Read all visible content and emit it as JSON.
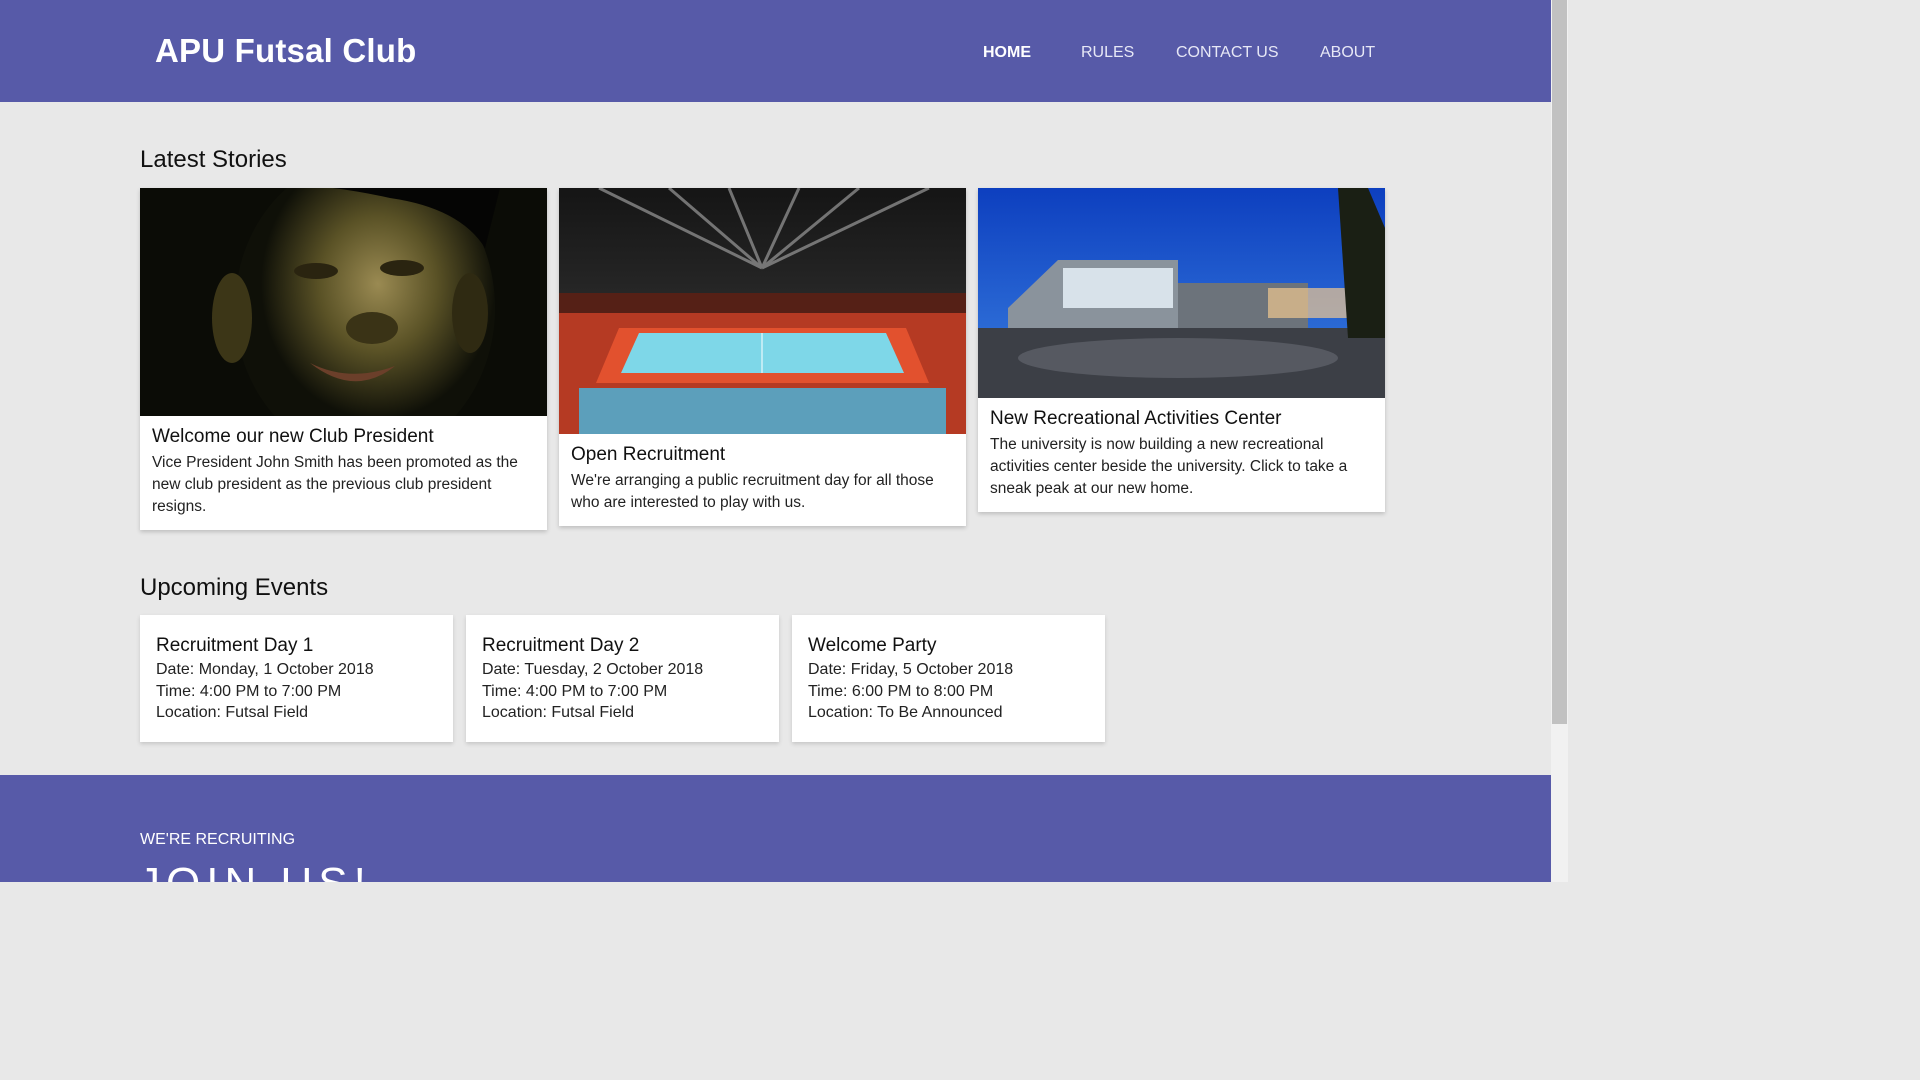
{
  "header": {
    "brand": "APU Futsal Club",
    "nav": [
      {
        "label": "HOME",
        "active": true
      },
      {
        "label": "RULES",
        "active": false
      },
      {
        "label": "CONTACT US",
        "active": false
      },
      {
        "label": "ABOUT",
        "active": false
      }
    ]
  },
  "stories": {
    "title": "Latest Stories",
    "items": [
      {
        "title": "Welcome our new Club President",
        "text": "Vice President John Smith has been promoted as the new club president as the previous club president resigns.",
        "image": "portrait-photo"
      },
      {
        "title": "Open Recruitment",
        "text": "We're arranging a public recruitment day for all those who are interested to play with us.",
        "image": "futsal-arena-photo"
      },
      {
        "title": "New Recreational Activities Center",
        "text": "The university is now building a new recreational activities center beside the university. Click to take a sneak peak at our new home.",
        "image": "building-night-photo"
      }
    ]
  },
  "events": {
    "title": "Upcoming Events",
    "items": [
      {
        "title": "Recruitment Day 1",
        "date": "Date: Monday, 1 October 2018",
        "time": "Time: 4:00 PM to 7:00 PM",
        "location": "Location: Futsal Field"
      },
      {
        "title": "Recruitment Day 2",
        "date": "Date: Tuesday, 2 October 2018",
        "time": "Time: 4:00 PM to 7:00 PM",
        "location": "Location: Futsal Field"
      },
      {
        "title": "Welcome Party",
        "date": "Date: Friday, 5 October 2018",
        "time": "Time: 6:00 PM to 8:00 PM",
        "location": "Location: To Be Announced"
      }
    ]
  },
  "recruit": {
    "kicker": "WE'RE RECRUITING",
    "headline": "JOIN US!"
  },
  "colors": {
    "header_bg": "#575aa8",
    "page_bg": "#e8e8e8",
    "card_bg": "#ffffff"
  }
}
